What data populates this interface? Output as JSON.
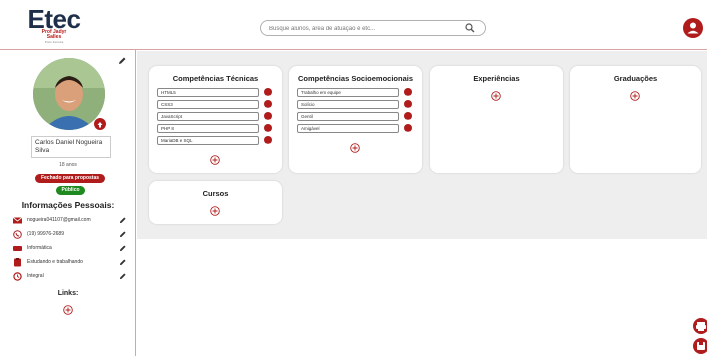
{
  "header": {
    "logo_main": "Etec",
    "logo_sub1": "Prof Jadyr",
    "logo_sub2": "Salles",
    "logo_sub3": "Porto Ferreira",
    "search_placeholder": "Busque alunos, área de atuação e etc..."
  },
  "profile": {
    "name": "Carlos Daniel Nogueira Silva",
    "age": "18 anos",
    "status_proposals": "Fechado para propostas",
    "visibility": "Público",
    "info_title": "Informações Pessoais:",
    "info": [
      {
        "icon": "email-icon",
        "text": "nogueira041107@gmail.com"
      },
      {
        "icon": "whatsapp-icon",
        "text": "(19) 99976-2689"
      },
      {
        "icon": "course-icon",
        "text": "Informática"
      },
      {
        "icon": "status-icon",
        "text": "Estudando e trabalhando"
      },
      {
        "icon": "clock-icon",
        "text": "Integral"
      }
    ],
    "links_title": "Links:"
  },
  "cards": {
    "tecnicas": {
      "title": "Competências Técnicas",
      "items": [
        "HTML5",
        "CSS3",
        "JavaScript",
        "PHP 8",
        "MariaDB e SQL"
      ]
    },
    "socio": {
      "title": "Competências Socioemocionais",
      "items": [
        "Trabalho em equipe",
        "Solício",
        "Gentil",
        "Amigável"
      ]
    },
    "experiencias": {
      "title": "Experiências"
    },
    "graduacoes": {
      "title": "Graduações"
    },
    "cursos": {
      "title": "Cursos"
    }
  },
  "colors": {
    "accent": "#b01c1c",
    "navy": "#1f2f49",
    "green": "#1f8a1f"
  }
}
